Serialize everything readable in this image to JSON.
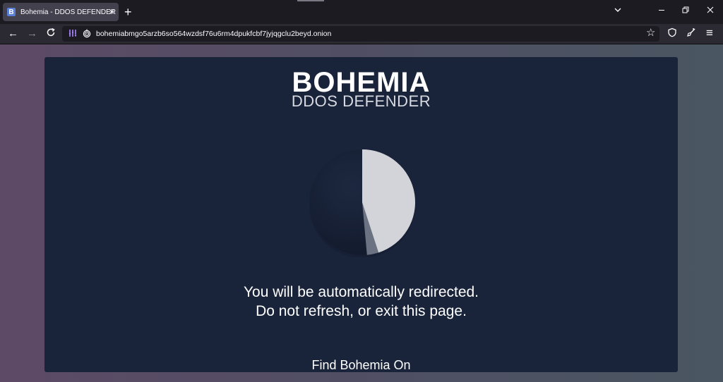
{
  "browser": {
    "tab": {
      "title": "Bohemia - DDOS DEFENDER",
      "favicon_letter": "B"
    },
    "url": "bohemiabmgo5arzb6so564wzdsf76u6rm4dpukfcbf7jyjqgclu2beyd.onion",
    "icons": {
      "close_tab": "×",
      "new_tab": "+",
      "list_tabs": "chevron-down-icon",
      "minimize": "minimize-icon",
      "restore": "restore-icon",
      "close_window": "close-icon",
      "back": "←",
      "forward": "→",
      "reload": "reload-icon",
      "onion": "onion-circuit-icon",
      "lock": "onion-lock-icon",
      "bookmark": "☆",
      "shield": "shield-icon",
      "clear": "broom-icon",
      "menu": "≡"
    }
  },
  "page": {
    "logo_title": "BOHEMIA",
    "logo_subtitle": "DDOS DEFENDER",
    "message_line1": "You will be automatically redirected.",
    "message_line2": "Do not refresh, or exit this page.",
    "footer": "Find Bohemia On",
    "spinner_progress": 0.45,
    "colors": {
      "card": "#19233a",
      "spinner_fill": "#d3d4d9",
      "spinner_shadow": "#6b7282",
      "text": "#ffffff"
    }
  }
}
